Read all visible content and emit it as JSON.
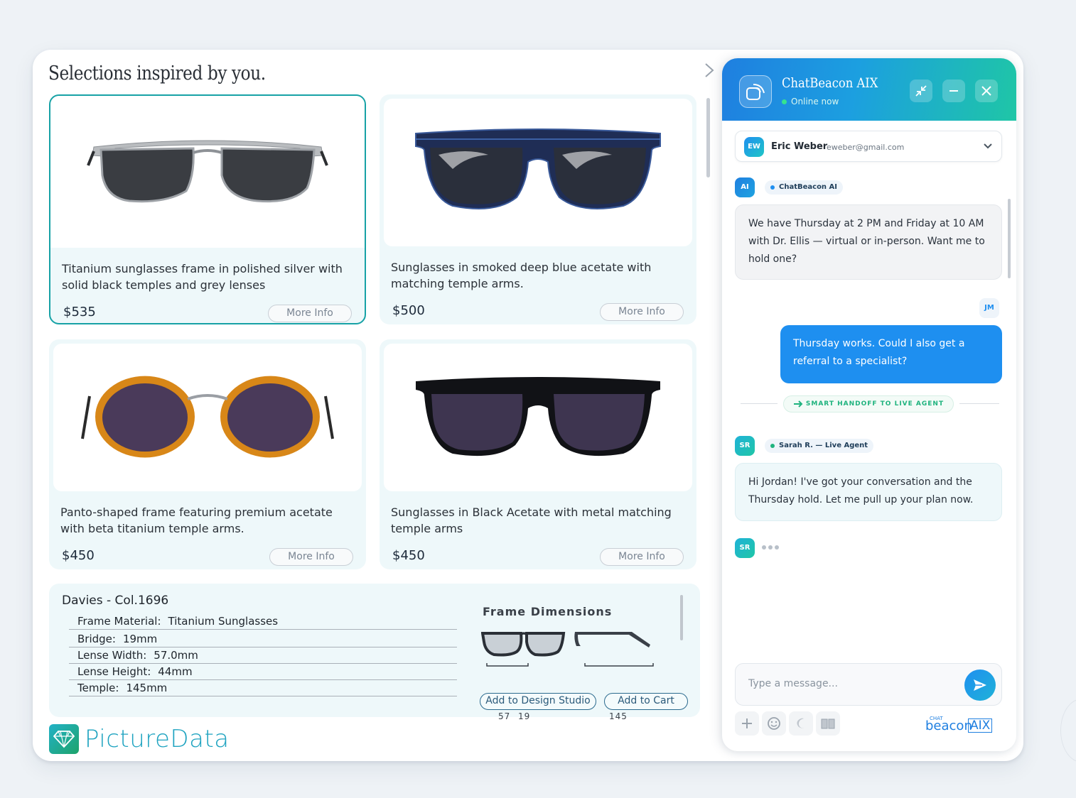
{
  "page": {
    "title": "Selections inspired by you."
  },
  "products": [
    {
      "description": "Titanium sunglasses frame in polished silver with solid black temples and grey lenses",
      "price": "$535",
      "more_label": "More Info",
      "selected": true
    },
    {
      "description": "Sunglasses in smoked deep blue acetate with matching temple arms.",
      "price": "$500",
      "more_label": "More Info",
      "selected": false
    },
    {
      "description": "Panto-shaped frame featuring premium acetate with beta titanium temple arms.",
      "price": "$450",
      "more_label": "More Info",
      "selected": false
    },
    {
      "description": "Sunglasses in Black Acetate with metal matching temple arms",
      "price": "$450",
      "more_label": "More Info",
      "selected": false
    }
  ],
  "details": {
    "model": "Davies - Col.1696",
    "specs": [
      {
        "label": "Frame Material:",
        "value": "Titanium Sunglasses"
      },
      {
        "label": "Bridge:",
        "value": "19mm"
      },
      {
        "label": "Lense Width:",
        "value": "57.0mm"
      },
      {
        "label": "Lense Height:",
        "value": "44mm"
      },
      {
        "label": "Temple:",
        "value": "145mm"
      }
    ],
    "dimensions_title": "Frame Dimensions",
    "dim_lens": "57",
    "dim_bridge": "19",
    "dim_temple": "145",
    "add_design_label": "Add to Design Studio",
    "add_cart_label": "Add to Cart"
  },
  "brand": {
    "name": "PictureData"
  },
  "chat": {
    "title": "ChatBeacon AIX",
    "status": "Online now",
    "user": {
      "initials": "EW",
      "name": "Eric Weber",
      "email": "eweber@gmail.com"
    },
    "bot": {
      "initials": "AI",
      "chip": "ChatBeacon AI"
    },
    "messages": {
      "bot_1": "We have Thursday at 2 PM and Friday at 10 AM with Dr. Ellis — virtual or in-person. Want me to hold one?",
      "me_initials": "JM",
      "me_1": "Thursday works. Could I also get a referral to a specialist?",
      "handoff": "SMART HANDOFF TO LIVE AGENT",
      "agent_initials": "SR",
      "agent_chip": "Sarah R. — Live Agent",
      "agent_1": "Hi Jordan! I've got your conversation and the Thursday hold. Let me pull up your plan now."
    },
    "input_placeholder": "Type a message...",
    "logo_small": "CHAT",
    "logo_text": "beacon",
    "logo_aix": "AIX"
  },
  "colors": {
    "accent_teal": "#17a2a6",
    "header_blue": "#1f7fe0",
    "header_green": "#1fc6a6",
    "user_bubble": "#1e8ff0",
    "online": "#36e38f"
  },
  "icons": [
    "chevron-right-icon",
    "bot-signal-icon",
    "collapse-icon",
    "minimize-icon",
    "close-icon",
    "chevron-down-icon",
    "send-icon",
    "plus-icon",
    "emoji-icon",
    "moon-icon",
    "book-icon",
    "diamond-icon"
  ]
}
